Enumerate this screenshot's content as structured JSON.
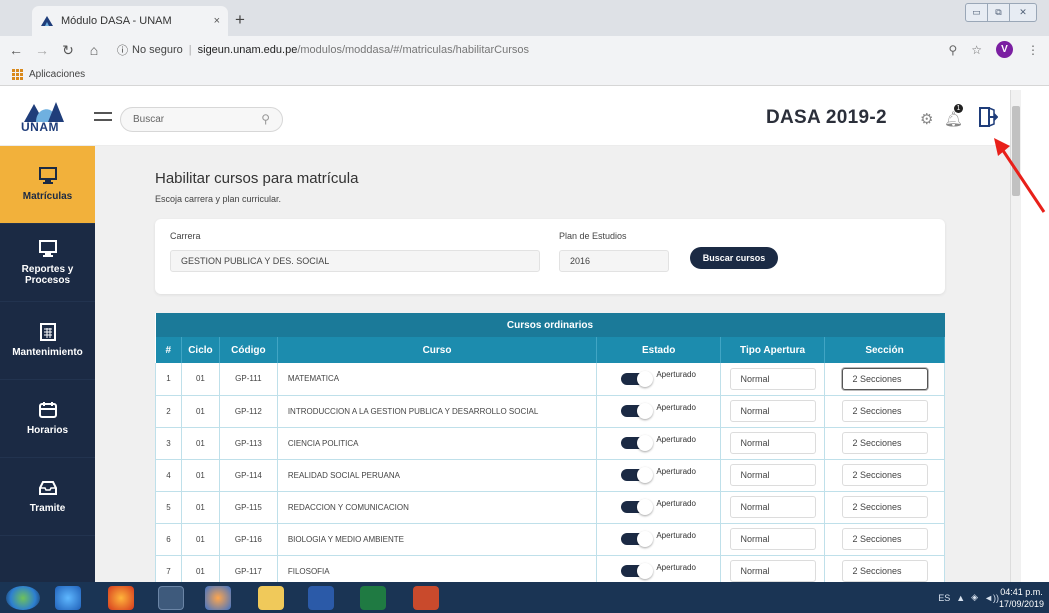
{
  "browser": {
    "tab_title": "Módulo DASA - UNAM",
    "tab_close": "×",
    "new_tab": "+",
    "security_label": "No seguro",
    "host": "sigeun.unam.edu.pe",
    "path": "/modulos/moddasa/#/matriculas/habilitarCursos",
    "profile_initial": "V",
    "bookmarks_apps": "Aplicaciones"
  },
  "header": {
    "logo_text": "UNAM",
    "search_placeholder": "Buscar",
    "title": "DASA 2019-2",
    "bell_badge": "1"
  },
  "sidebar": {
    "items": [
      {
        "label": "Matrículas",
        "icon": "monitor-icon",
        "active": true
      },
      {
        "label": "Reportes y Procesos",
        "icon": "monitor-icon",
        "active": false
      },
      {
        "label": "Mantenimiento",
        "icon": "calendar-icon",
        "active": false
      },
      {
        "label": "Horarios",
        "icon": "schedule-icon",
        "active": false
      },
      {
        "label": "Tramite",
        "icon": "inbox-icon",
        "active": false
      }
    ]
  },
  "page": {
    "title": "Habilitar cursos para matrícula",
    "subtitle": "Escoja carrera y plan curricular."
  },
  "filters": {
    "carrera_label": "Carrera",
    "carrera_value": "GESTION PUBLICA Y DES. SOCIAL",
    "plan_label": "Plan de Estudios",
    "plan_value": "2016",
    "buscar_button": "Buscar cursos"
  },
  "table": {
    "caption": "Cursos ordinarios",
    "headers": [
      "#",
      "Ciclo",
      "Código",
      "Curso",
      "Estado",
      "Tipo Apertura",
      "Sección"
    ],
    "rows": [
      {
        "n": "1",
        "ciclo": "01",
        "codigo": "GP-111",
        "curso": "MATEMATICA",
        "estado": "Aperturado",
        "tipo": "Normal",
        "seccion": "2 Secciones"
      },
      {
        "n": "2",
        "ciclo": "01",
        "codigo": "GP-112",
        "curso": "INTRODUCCION A LA GESTION PUBLICA Y DESARROLLO SOCIAL",
        "estado": "Aperturado",
        "tipo": "Normal",
        "seccion": "2 Secciones"
      },
      {
        "n": "3",
        "ciclo": "01",
        "codigo": "GP-113",
        "curso": "CIENCIA POLITICA",
        "estado": "Aperturado",
        "tipo": "Normal",
        "seccion": "2 Secciones"
      },
      {
        "n": "4",
        "ciclo": "01",
        "codigo": "GP-114",
        "curso": "REALIDAD SOCIAL PERUANA",
        "estado": "Aperturado",
        "tipo": "Normal",
        "seccion": "2 Secciones"
      },
      {
        "n": "5",
        "ciclo": "01",
        "codigo": "GP-115",
        "curso": "REDACCION Y COMUNICACION",
        "estado": "Aperturado",
        "tipo": "Normal",
        "seccion": "2 Secciones"
      },
      {
        "n": "6",
        "ciclo": "01",
        "codigo": "GP-116",
        "curso": "BIOLOGIA Y MEDIO AMBIENTE",
        "estado": "Aperturado",
        "tipo": "Normal",
        "seccion": "2 Secciones"
      },
      {
        "n": "7",
        "ciclo": "01",
        "codigo": "GP-117",
        "curso": "FILOSOFIA",
        "estado": "Aperturado",
        "tipo": "Normal",
        "seccion": "2 Secciones"
      }
    ]
  },
  "taskbar": {
    "lang": "ES",
    "time": "04:41 p.m.",
    "date": "17/09/2019"
  },
  "colors": {
    "sidebar": "#1b2a44",
    "active": "#f2b13b",
    "table_header": "#1c8cae",
    "annotation": "#e8201a"
  }
}
